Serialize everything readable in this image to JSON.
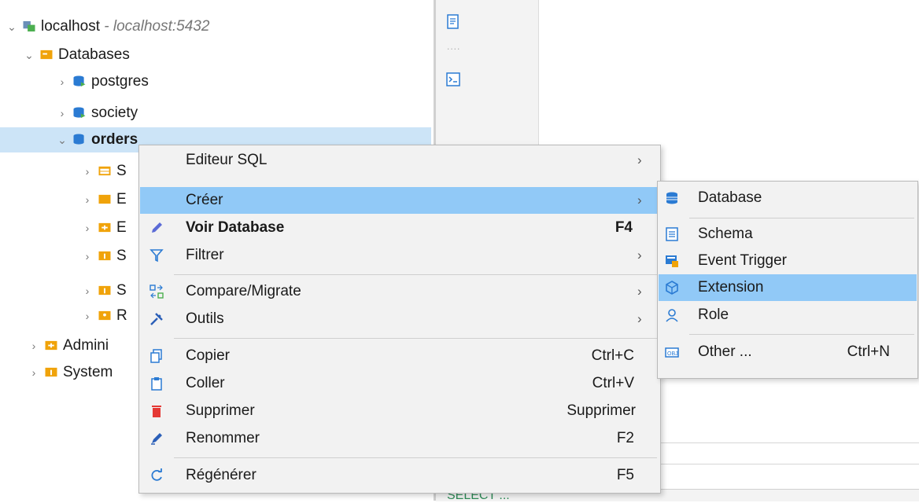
{
  "tree": {
    "root": {
      "label": "localhost",
      "detail": " - localhost:5432"
    },
    "databases": "Databases",
    "db_items": [
      "postgres",
      "society",
      "orders"
    ],
    "orders_children": [
      "S",
      "E",
      "E",
      "S",
      "S",
      "R"
    ],
    "admin": "Admini",
    "system": "System"
  },
  "context_menu": {
    "items": [
      {
        "label": "Editeur SQL",
        "shortcut": "",
        "submenu": true
      },
      {
        "label": "Créer",
        "shortcut": "",
        "submenu": true
      },
      {
        "label": "Voir Database",
        "shortcut": "F4",
        "submenu": false
      },
      {
        "label": "Filtrer",
        "shortcut": "",
        "submenu": true
      },
      {
        "label": "Compare/Migrate",
        "shortcut": "",
        "submenu": true
      },
      {
        "label": "Outils",
        "shortcut": "",
        "submenu": true
      },
      {
        "label": "Copier",
        "shortcut": "Ctrl+C",
        "submenu": false
      },
      {
        "label": "Coller",
        "shortcut": "Ctrl+V",
        "submenu": false
      },
      {
        "label": "Supprimer",
        "shortcut": "Supprimer",
        "submenu": false
      },
      {
        "label": "Renommer",
        "shortcut": "F2",
        "submenu": false
      },
      {
        "label": "Régénérer",
        "shortcut": "F5",
        "submenu": false
      }
    ]
  },
  "create_submenu": {
    "items": [
      {
        "label": "Database",
        "shortcut": ""
      },
      {
        "label": "Schema",
        "shortcut": ""
      },
      {
        "label": "Event Trigger",
        "shortcut": ""
      },
      {
        "label": "Extension",
        "shortcut": ""
      },
      {
        "label": "Role",
        "shortcut": ""
      },
      {
        "label": "Other ...",
        "shortcut": "Ctrl+N"
      }
    ]
  },
  "colors": {
    "selection": "#cce4f7",
    "menu_highlight": "#91c9f7",
    "folder": "#f0a30a",
    "db_blue": "#2b7bd3",
    "delete_red": "#e53935"
  },
  "icons": [
    "server-icon",
    "folder-icon",
    "database-icon",
    "schema-icon",
    "event-trigger-icon",
    "extension-icon",
    "role-icon",
    "other-object-icon",
    "pencil-icon",
    "filter-icon",
    "compare-icon",
    "tools-icon",
    "copy-icon",
    "paste-icon",
    "trash-icon",
    "rename-icon",
    "refresh-icon",
    "sql-script-icon",
    "console-icon"
  ],
  "bottom": {
    "sql_preview": "SELECT ... "
  }
}
